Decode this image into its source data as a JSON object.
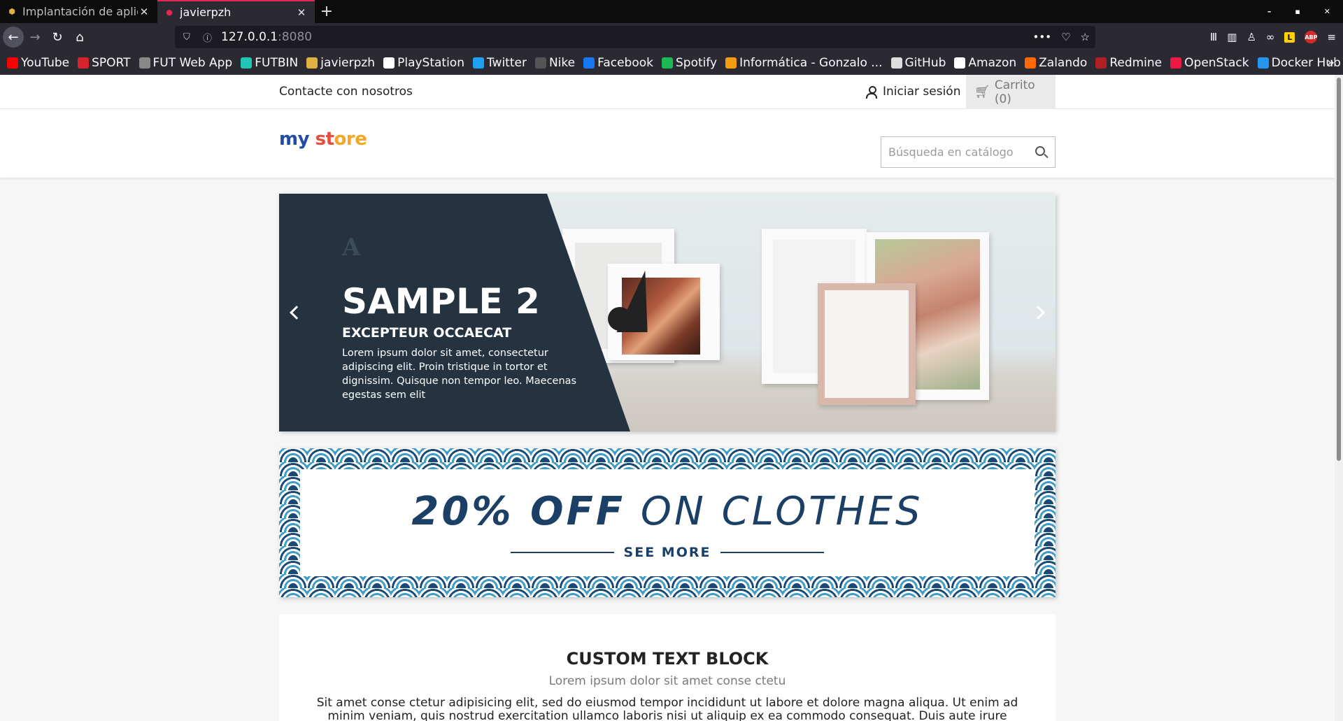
{
  "browser": {
    "tabs": [
      {
        "title": "Implantación de aplic",
        "active": false
      },
      {
        "title": "javierpzh",
        "active": true
      }
    ],
    "url_host": "127.0.0.1",
    "url_port": ":8080",
    "bookmarks": [
      {
        "label": "YouTube",
        "icon": "youtube-icon",
        "color": "#ff0000"
      },
      {
        "label": "SPORT",
        "icon": "sport-icon",
        "color": "#d8232a"
      },
      {
        "label": "FUT Web App",
        "icon": "globe-icon",
        "color": "#888888"
      },
      {
        "label": "FUTBIN",
        "icon": "futbin-icon",
        "color": "#20c5b6"
      },
      {
        "label": "javierpzh",
        "icon": "javierpzh-icon",
        "color": "#e0b040"
      },
      {
        "label": "PlayStation",
        "icon": "playstation-icon",
        "color": "#ffffff"
      },
      {
        "label": "Twitter",
        "icon": "twitter-icon",
        "color": "#1da1f2"
      },
      {
        "label": "Nike",
        "icon": "nike-icon",
        "color": "#555555"
      },
      {
        "label": "Facebook",
        "icon": "facebook-icon",
        "color": "#1877f2"
      },
      {
        "label": "Spotify",
        "icon": "spotify-icon",
        "color": "#1db954"
      },
      {
        "label": "Informática - Gonzalo ...",
        "icon": "informatica-icon",
        "color": "#f39c12"
      },
      {
        "label": "GitHub",
        "icon": "github-icon",
        "color": "#dddddd"
      },
      {
        "label": "Amazon",
        "icon": "amazon-icon",
        "color": "#ffffff"
      },
      {
        "label": "Zalando",
        "icon": "zalando-icon",
        "color": "#ff6900"
      },
      {
        "label": "Redmine",
        "icon": "redmine-icon",
        "color": "#b32024"
      },
      {
        "label": "OpenStack",
        "icon": "openstack-icon",
        "color": "#ed1944"
      },
      {
        "label": "Docker Hub",
        "icon": "docker-icon",
        "color": "#2496ed"
      }
    ]
  },
  "store": {
    "contact": "Contacte con nosotros",
    "signin": "Iniciar sesión",
    "cart": "Carrito (0)",
    "logo": {
      "part1": "my",
      "part2": " ",
      "part3": "st",
      "part4": "ore"
    },
    "search_placeholder": "Búsqueda en catálogo"
  },
  "slide": {
    "glyph": "A",
    "title": "SAMPLE 2",
    "subtitle": "EXCEPTEUR OCCAECAT",
    "text": "Lorem ipsum dolor sit amet, consectetur adipiscing elit. Proin tristique in tortor et dignissim. Quisque non tempor leo. Maecenas egestas sem elit"
  },
  "banner": {
    "bold": "20% OFF",
    "rest": " ON CLOTHES",
    "see_more": "SEE MORE"
  },
  "custom_text": {
    "title": "CUSTOM TEXT BLOCK",
    "subtitle": "Lorem ipsum dolor sit amet conse ctetu",
    "body": "Sit amet conse ctetur adipisicing elit, sed do eiusmod tempor incididunt ut labore et dolore magna aliqua. Ut enim ad minim veniam, quis nostrud exercitation ullamco laboris nisi ut aliquip ex ea commodo consequat. Duis aute irure dolor in"
  }
}
